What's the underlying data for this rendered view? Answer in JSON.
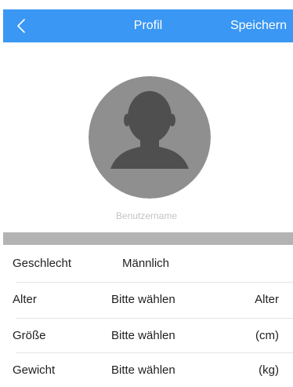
{
  "header": {
    "title": "Profil",
    "save_label": "Speichern",
    "back_icon": "chevron-left-icon",
    "bar_color": "#3a97f3"
  },
  "profile": {
    "avatar_icon": "user-avatar-placeholder-icon",
    "username_placeholder": "Benutzername"
  },
  "fields": [
    {
      "label": "Geschlecht",
      "value": "Männlich",
      "unit": ""
    },
    {
      "label": "Alter",
      "value": "Bitte wählen",
      "unit": "Alter"
    },
    {
      "label": "Größe",
      "value": "Bitte wählen",
      "unit": "(cm)"
    },
    {
      "label": "Gewicht",
      "value": "Bitte wählen",
      "unit": "(kg)"
    }
  ]
}
